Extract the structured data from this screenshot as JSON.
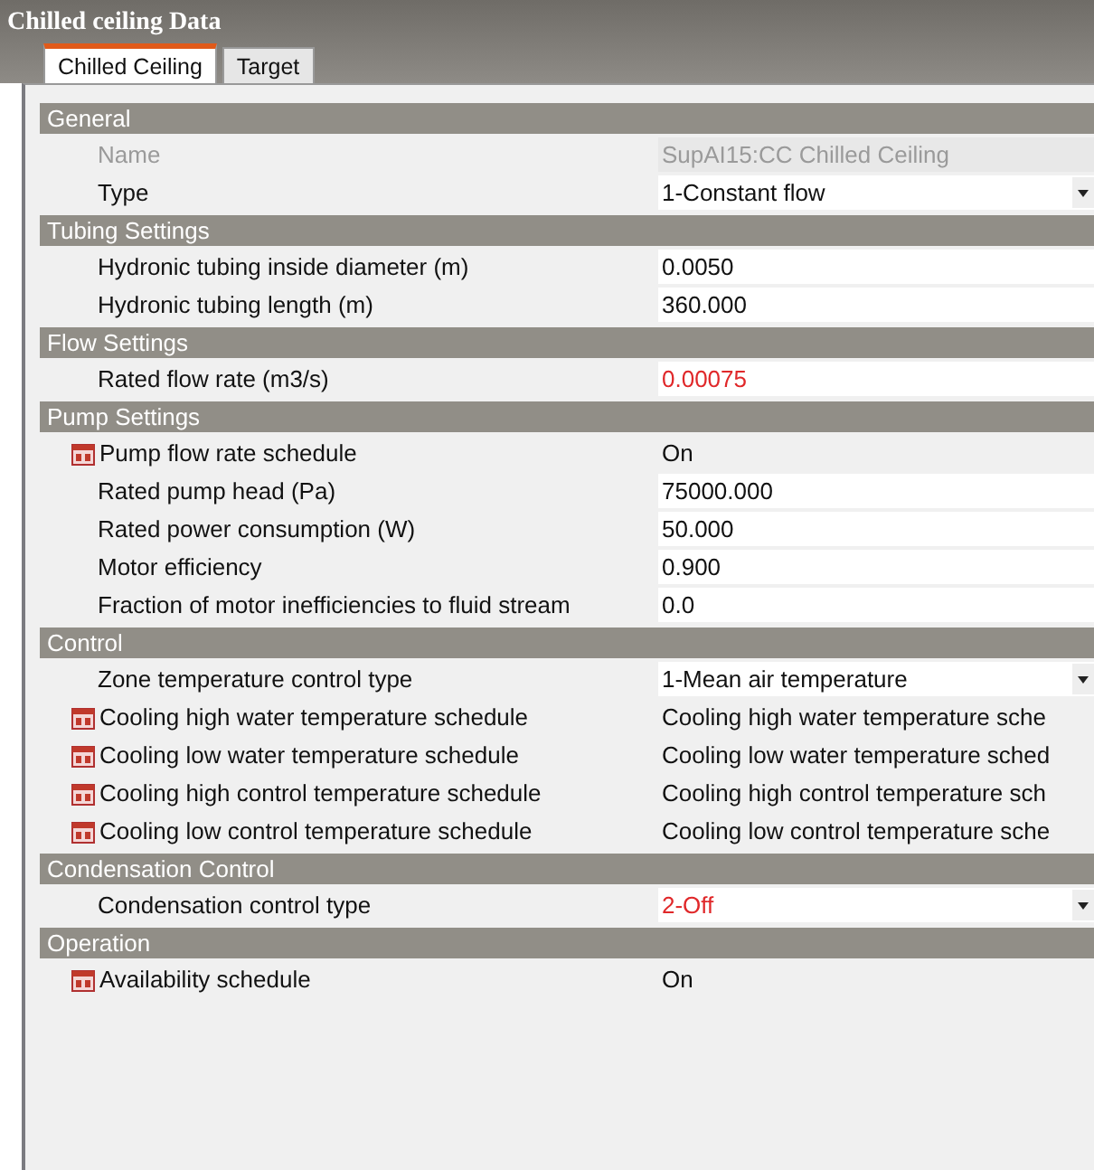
{
  "window": {
    "title": "Chilled ceiling Data"
  },
  "tabs": [
    {
      "label": "Chilled Ceiling",
      "selected": true
    },
    {
      "label": "Target",
      "selected": false
    }
  ],
  "sections": [
    {
      "title": "General",
      "rows": [
        {
          "label": "Name",
          "value": "SupAI15:CC Chilled Ceiling",
          "kind": "readonly",
          "flagged": false
        },
        {
          "label": "Type",
          "value": "1-Constant flow",
          "kind": "dropdown",
          "flagged": false
        }
      ]
    },
    {
      "title": "Tubing Settings",
      "rows": [
        {
          "label": "Hydronic tubing inside diameter (m)",
          "value": "0.0050",
          "kind": "text",
          "flagged": false
        },
        {
          "label": "Hydronic tubing length (m)",
          "value": "360.000",
          "kind": "text",
          "flagged": false
        }
      ]
    },
    {
      "title": "Flow Settings",
      "rows": [
        {
          "label": "Rated flow rate (m3/s)",
          "value": "0.00075",
          "kind": "text",
          "flagged": true
        }
      ]
    },
    {
      "title": "Pump Settings",
      "rows": [
        {
          "label": "Pump flow rate schedule",
          "value": "On",
          "kind": "schedule",
          "flagged": false
        },
        {
          "label": "Rated pump head (Pa)",
          "value": "75000.000",
          "kind": "text",
          "flagged": false
        },
        {
          "label": "Rated power consumption (W)",
          "value": "50.000",
          "kind": "text",
          "flagged": false
        },
        {
          "label": "Motor efficiency",
          "value": "0.900",
          "kind": "text",
          "flagged": false
        },
        {
          "label": "Fraction of motor inefficiencies to fluid stream",
          "value": "0.0",
          "kind": "text",
          "flagged": false
        }
      ]
    },
    {
      "title": "Control",
      "rows": [
        {
          "label": "Zone temperature control type",
          "value": "1-Mean air temperature",
          "kind": "dropdown",
          "flagged": false
        },
        {
          "label": "Cooling high water temperature schedule",
          "value": "Cooling high water temperature sche",
          "kind": "schedule",
          "flagged": false
        },
        {
          "label": "Cooling low water temperature schedule",
          "value": "Cooling low water temperature sched",
          "kind": "schedule",
          "flagged": false
        },
        {
          "label": "Cooling high control temperature schedule",
          "value": "Cooling high control temperature sch",
          "kind": "schedule",
          "flagged": false
        },
        {
          "label": "Cooling low control temperature schedule",
          "value": "Cooling low control temperature sche",
          "kind": "schedule",
          "flagged": false
        }
      ]
    },
    {
      "title": "Condensation Control",
      "rows": [
        {
          "label": "Condensation control type",
          "value": "2-Off",
          "kind": "dropdown",
          "flagged": true
        }
      ]
    },
    {
      "title": "Operation",
      "rows": [
        {
          "label": "Availability schedule",
          "value": "On",
          "kind": "schedule",
          "flagged": false
        }
      ]
    }
  ]
}
